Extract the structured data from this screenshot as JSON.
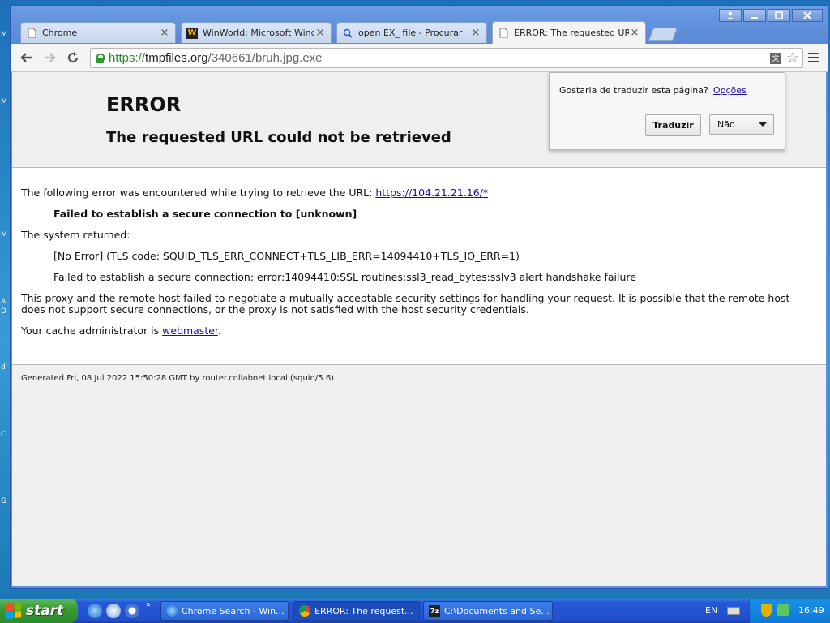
{
  "desktop": {
    "side_glyphs": [
      "M",
      "M",
      "M",
      "A",
      "D",
      "d",
      "C",
      "G"
    ]
  },
  "window": {
    "tabs": [
      {
        "label": "Chrome",
        "icon": "page-icon"
      },
      {
        "label": "WinWorld: Microsoft Window",
        "icon": "winworld-icon"
      },
      {
        "label": "open EX_ file - Procurar",
        "icon": "search-icon"
      },
      {
        "label": "ERROR: The requested URL",
        "icon": "page-icon",
        "active": true
      }
    ],
    "close_glyph": "×"
  },
  "toolbar": {
    "url_scheme": "https://",
    "url_host": "tmpfiles.org",
    "url_path": "/340661/bruh.jpg.exe"
  },
  "translate": {
    "question": "Gostaria de traduzir esta página?",
    "options_label": "Opções",
    "translate_label": "Traduzir",
    "no_label": "Não"
  },
  "error_page": {
    "title": "ERROR",
    "subtitle": "The requested URL could not be retrieved",
    "intro": "The following error was encountered while trying to retrieve the URL: ",
    "url_link": "https://104.21.21.16/*",
    "failure": "Failed to establish a secure connection to [unknown]",
    "system_returned": "The system returned:",
    "error_code": "[No Error] (TLS code: SQUID_TLS_ERR_CONNECT+TLS_LIB_ERR=14094410+TLS_IO_ERR=1)",
    "error_detail": "Failed to establish a secure connection: error:14094410:SSL routines:ssl3_read_bytes:sslv3 alert handshake failure",
    "explain_1": "This proxy and the remote host failed to negotiate a mutually acceptable security settings for handling your request. It is possible that the remote host",
    "explain_2": "does not support secure connections, or the proxy is not satisfied with the host security credentials.",
    "admin_prefix": "Your cache administrator is ",
    "admin_link": "webmaster",
    "admin_suffix": ".",
    "footer": "Generated Fri, 08 Jul 2022 15:50:28 GMT by router.collabnet.local (squid/5.6)"
  },
  "taskbar": {
    "start_label": "start",
    "tasks": [
      {
        "label": "Chrome Search - Win...",
        "icon": "ie-icon"
      },
      {
        "label": "ERROR: The request...",
        "icon": "chrome-icon",
        "active": true
      },
      {
        "label": "C:\\Documents and Se...",
        "icon": "7zip-icon"
      }
    ],
    "language": "EN",
    "clock": "16:49"
  },
  "colors": {
    "accent": "#1a0dab",
    "secure": "#2b9a2b"
  }
}
